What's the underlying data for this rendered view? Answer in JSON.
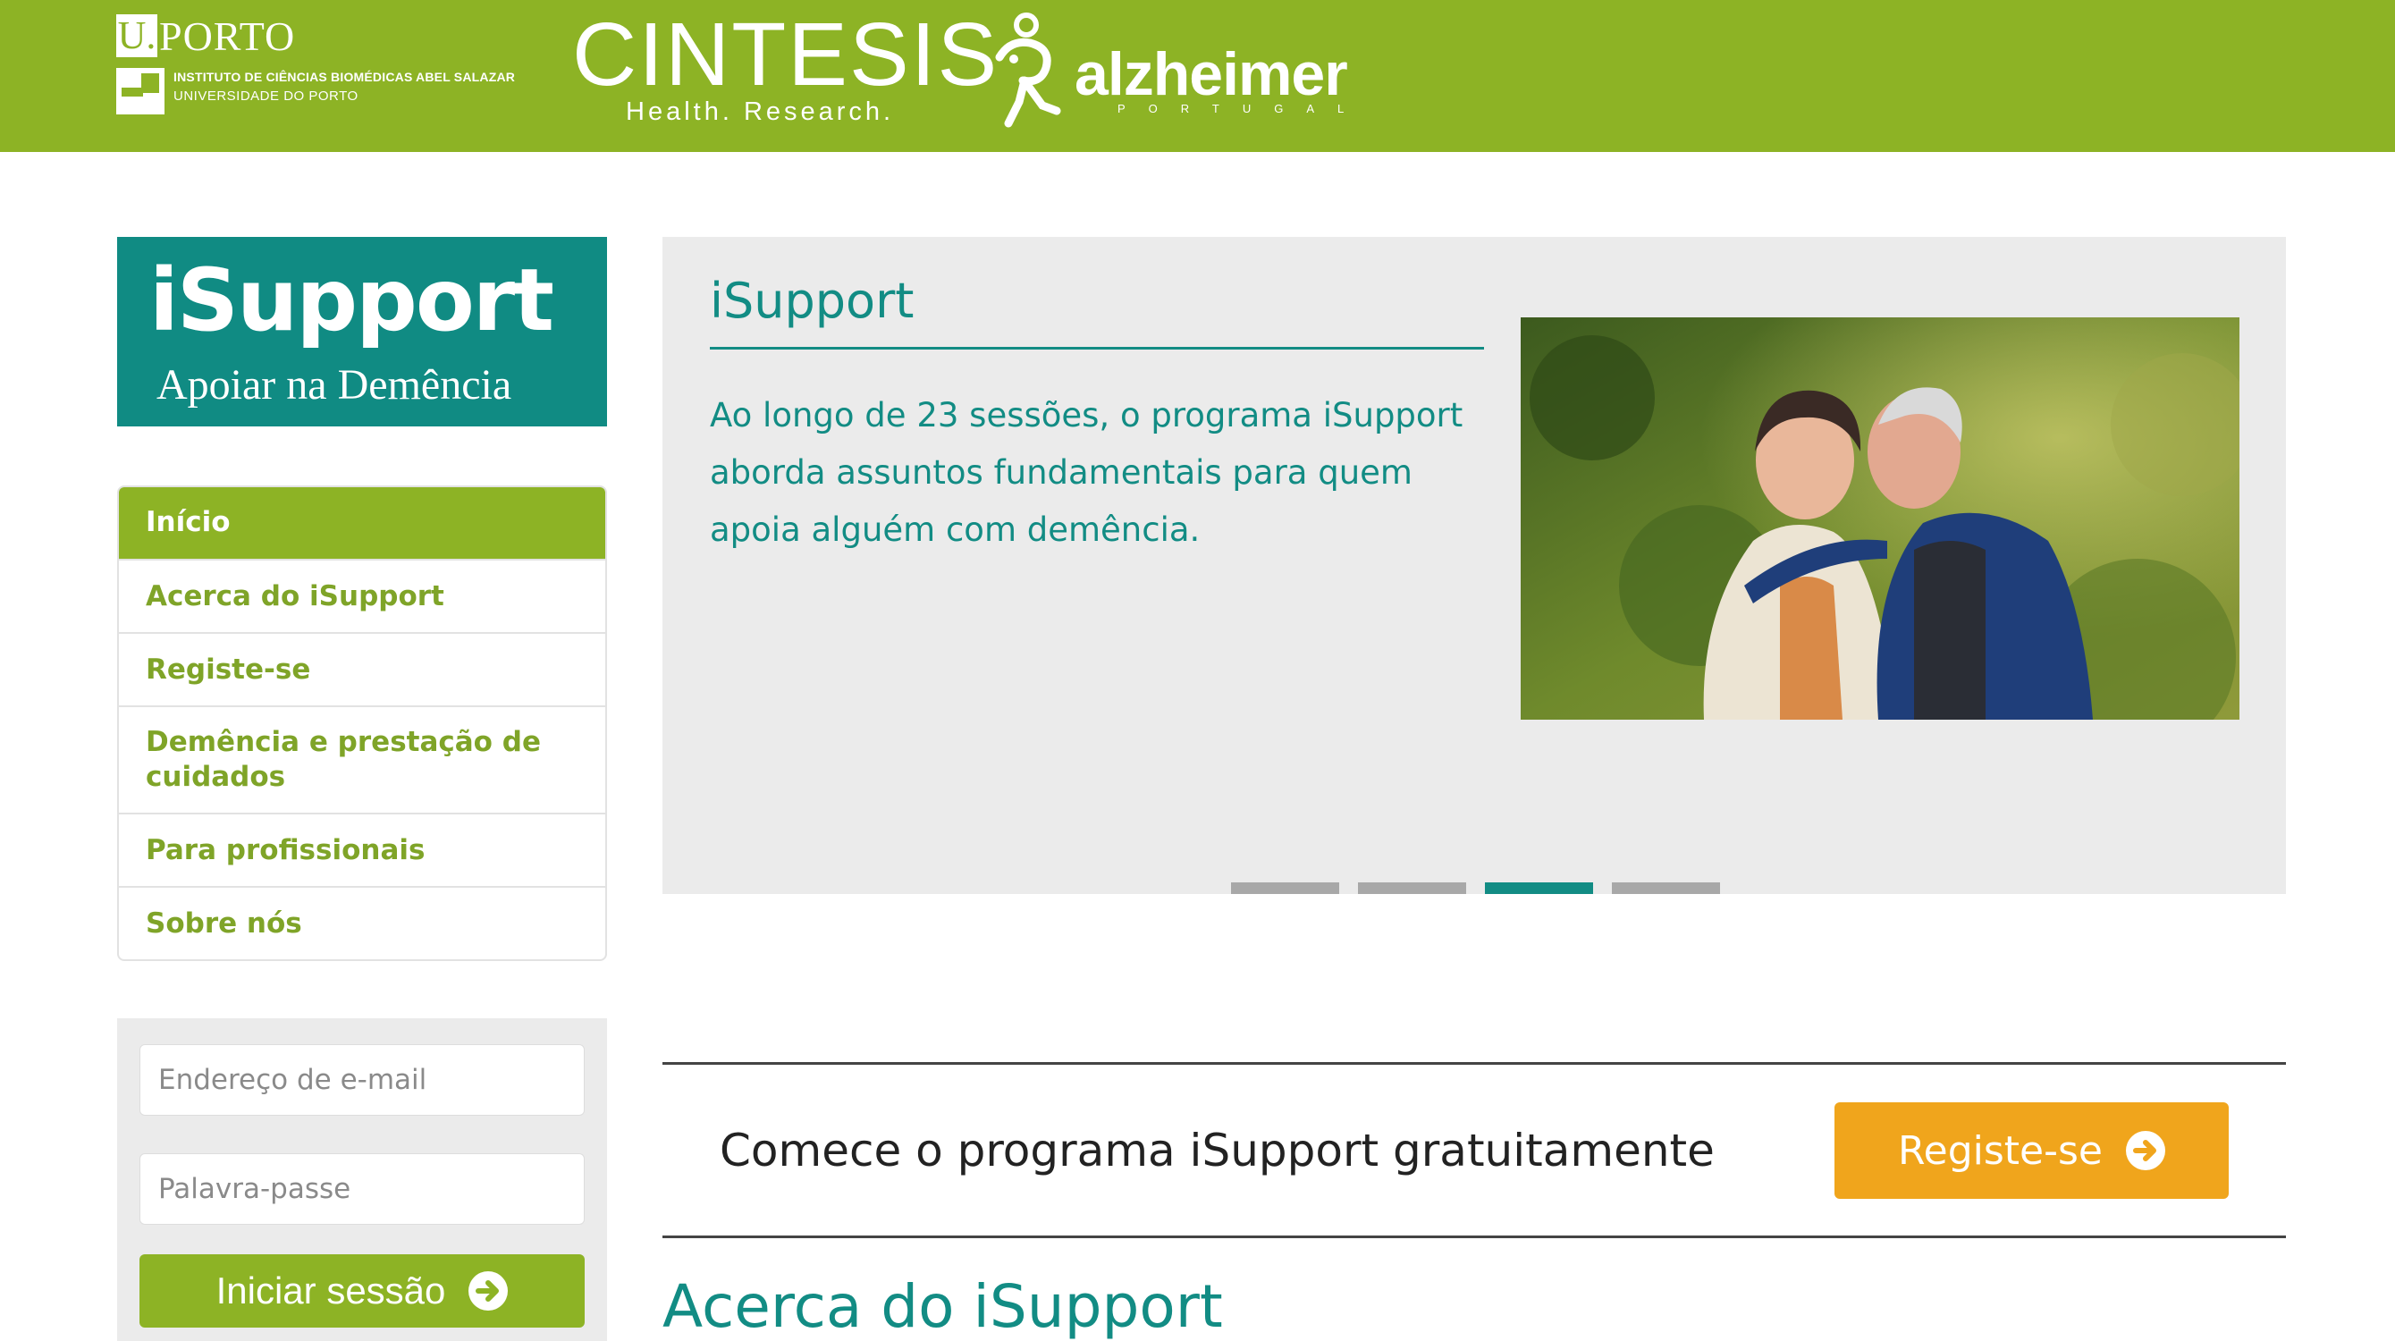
{
  "header": {
    "uporto": {
      "u": "U.",
      "porto": "PORTO",
      "institute": "INSTITUTO DE CIÊNCIAS BIOMÉDICAS ABEL SALAZAR",
      "university": "UNIVERSIDADE DO PORTO"
    },
    "cintesis": {
      "name": "CINTESIS",
      "tagline": "Health. Research."
    },
    "alzheimer": {
      "name": "alzheimer",
      "sub": "PORTUGAL"
    },
    "bar_color": "#8db325"
  },
  "brand": {
    "title": "iSupport",
    "subtitle": "Apoiar na Demência",
    "color": "#108b83"
  },
  "nav": {
    "items": [
      {
        "label": "Início"
      },
      {
        "label": "Acerca do iSupport"
      },
      {
        "label": "Registe-se"
      },
      {
        "label": "Demência e prestação de cuidados"
      },
      {
        "label": "Para profissionais"
      },
      {
        "label": "Sobre nós"
      }
    ],
    "active_index": 0
  },
  "login": {
    "email_placeholder": "Endereço de e-mail",
    "email_value": "",
    "password_placeholder": "Palavra-passe",
    "password_value": "",
    "submit_label": "Iniciar sessão",
    "submit_icon": "arrow-right-circle-icon"
  },
  "carousel": {
    "title": "iSupport",
    "text": "Ao longo de 23 sessões, o programa iSupport aborda assuntos fundamentais para quem apoia alguém com demência.",
    "image": "photo-elderly-couple-kiss",
    "slide_count": 4,
    "active_slide": 3,
    "accent_color": "#128c84"
  },
  "cta": {
    "text": "Comece o programa iSupport gratuitamente",
    "button_label": "Registe-se",
    "button_icon": "arrow-right-circle-icon",
    "button_color": "#f0a51c"
  },
  "section": {
    "heading": "Acerca do iSupport"
  }
}
